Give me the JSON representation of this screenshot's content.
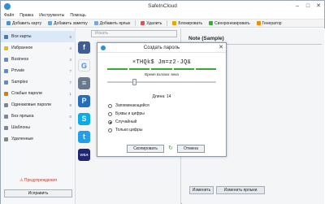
{
  "app": {
    "title": "SafeInCloud"
  },
  "window_controls": {
    "minimize": "–",
    "maximize": "□",
    "close": "✕"
  },
  "menu": [
    "Файл",
    "Правка",
    "Инструменты",
    "Помощь"
  ],
  "toolbar": {
    "add_card": "Добавить карту",
    "add_note": "Добавить заметку",
    "add_label": "Добавить ярлык",
    "delete": "Удалить",
    "lock": "Блокировать",
    "sync": "Синхронизировать",
    "generator": "Генератор"
  },
  "sidebar": {
    "items": [
      {
        "label": "Все карты",
        "count": "9",
        "icon": "folder-icon",
        "color": "#4a78b8"
      },
      {
        "label": "Избранное",
        "count": "4",
        "icon": "star-icon",
        "color": "#f2b707"
      },
      {
        "label": "Business",
        "count": "3",
        "icon": "label-icon",
        "color": "#5b8bd6"
      },
      {
        "label": "Private",
        "count": "7",
        "icon": "label-icon",
        "color": "#5b8bd6"
      },
      {
        "label": "Samples",
        "count": "7",
        "icon": "label-icon",
        "color": "#5b8bd6"
      },
      {
        "label": "Слабые пароли",
        "count": "1",
        "icon": "warning-icon",
        "color": "#e07b00"
      },
      {
        "label": "Одинаковые пароли",
        "count": "8",
        "icon": "duplicate-icon",
        "color": "#7b8794"
      },
      {
        "label": "Без ярлыка",
        "count": "0",
        "icon": "no-label-icon",
        "color": "#7b8794"
      },
      {
        "label": "Шаблоны",
        "count": "8",
        "icon": "template-icon",
        "color": "#7b8794"
      },
      {
        "label": "Удаленные",
        "count": "",
        "icon": "trash-icon",
        "color": "#7b8794"
      }
    ],
    "warning": "⚠ Предупреждения",
    "fix_button": "Исправить"
  },
  "list": {
    "search_placeholder": "Искать",
    "cards": [
      {
        "icon": "facebook-icon",
        "glyph": "f",
        "color": "#3b5998"
      },
      {
        "icon": "google-icon",
        "glyph": "G",
        "color": "#ffffff"
      },
      {
        "icon": "document-icon",
        "glyph": "≡",
        "color": "#6a7a8c"
      },
      {
        "icon": "paypal-icon",
        "glyph": "P",
        "color": "#1f6dc1"
      },
      {
        "icon": "skype-icon",
        "glyph": "S",
        "color": "#00aff0"
      },
      {
        "icon": "twitter-icon",
        "glyph": "t",
        "color": "#1da1f2"
      },
      {
        "icon": "visa-icon",
        "glyph": "VISA",
        "color": "#1a1f71"
      }
    ]
  },
  "detail": {
    "title": "Note (Sample)",
    "edit_button": "Изменить",
    "edit_label_button": "Изменить ярлыки"
  },
  "dialog": {
    "title": "Создать пароль",
    "password": "×THQk$ Jm=z2·JQ&",
    "crack_time": "Время взлома: века",
    "slider_value": 14,
    "length_label": "Длина: 14",
    "options": [
      {
        "label": "Запоминающийся",
        "selected": false
      },
      {
        "label": "Буквы и цифры",
        "selected": false
      },
      {
        "label": "Случайный",
        "selected": true
      },
      {
        "label": "Только цифры",
        "selected": false
      }
    ],
    "copy_button": "Скопировать",
    "cancel_button": "Отмена",
    "strength_color": "#3aa83a"
  }
}
